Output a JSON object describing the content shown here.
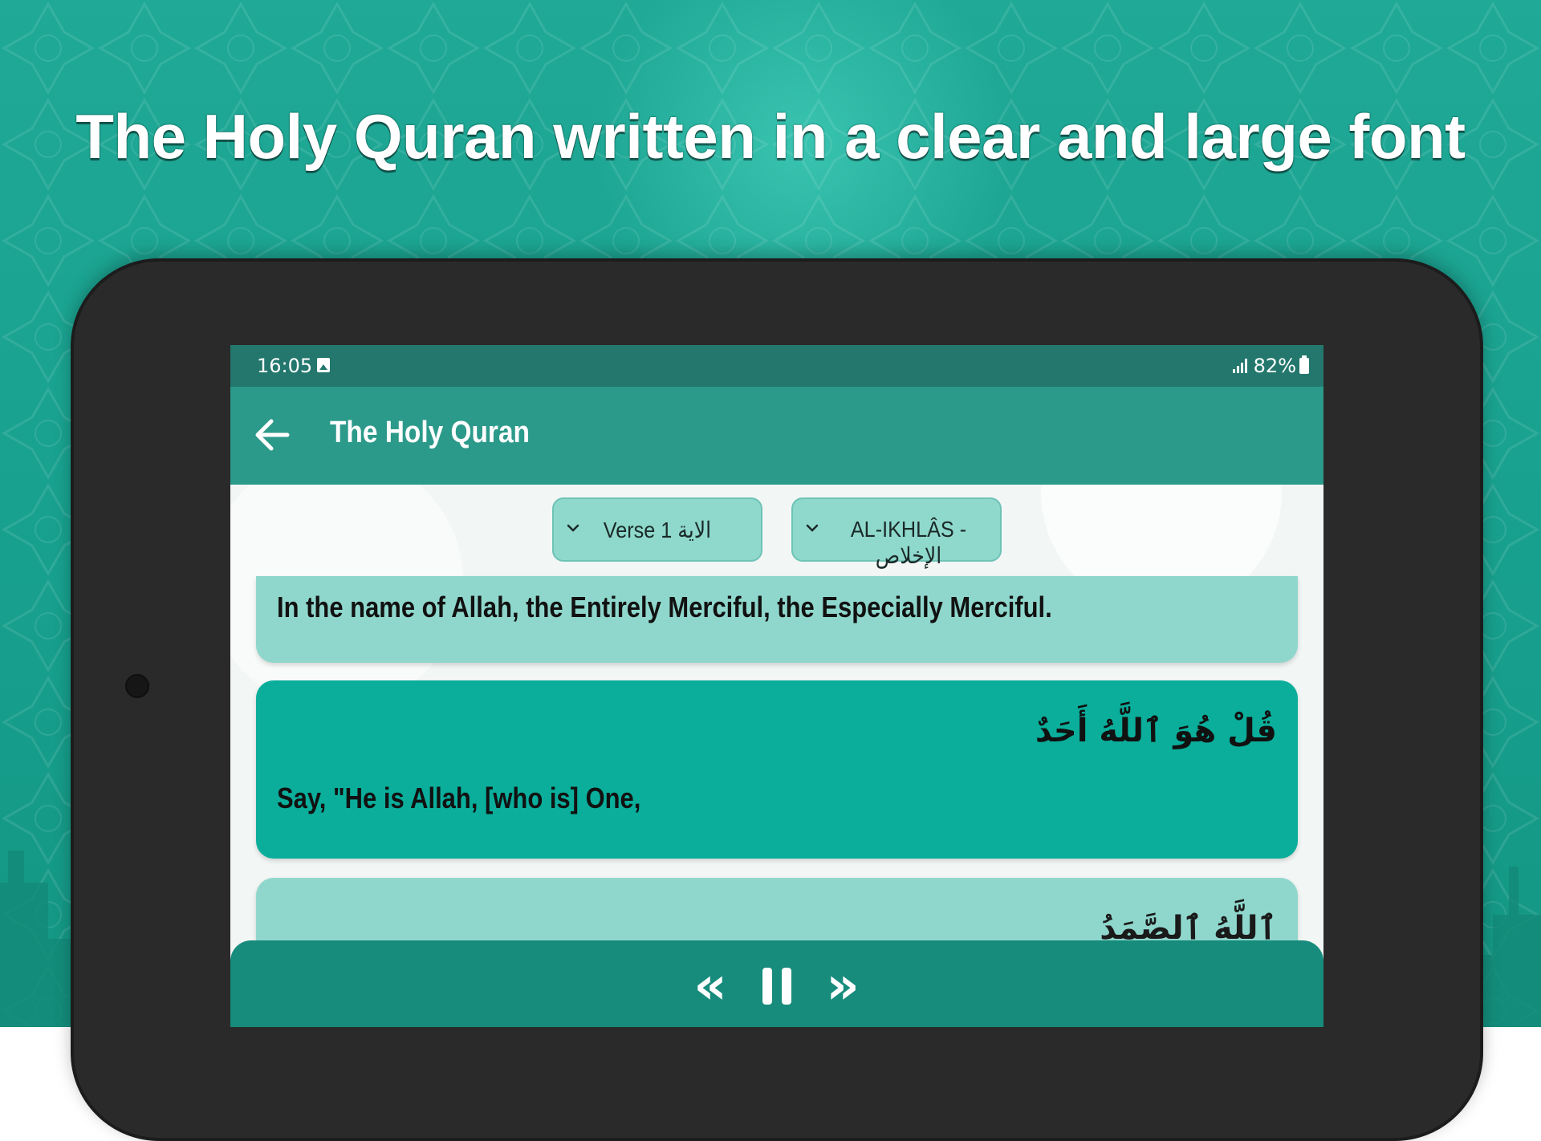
{
  "headline": "The Holy Quran written in a clear and large font",
  "status_bar": {
    "time": "16:05",
    "battery": "82%",
    "icons": [
      "image-icon",
      "signal-icon",
      "battery-icon"
    ]
  },
  "app_bar": {
    "title": "The Holy Quran",
    "back_icon": "arrow-left-icon"
  },
  "selectors": {
    "verse": "Verse 1 الاية",
    "surah": "AL-IKHLÂS - الإخلاص"
  },
  "verses": [
    {
      "arabic": "",
      "translation": "In the name of Allah, the Entirely Merciful, the Especially Merciful."
    },
    {
      "arabic": "قُلْ هُوَ ٱللَّهُ أَحَدٌ",
      "translation": "Say, \"He is Allah, [who is] One,"
    },
    {
      "arabic": "ٱللَّهُ ٱلصَّمَدُ",
      "translation": ""
    }
  ],
  "player": {
    "prev_icon": "double-chevron-left-icon",
    "pause_icon": "pause-icon",
    "next_icon": "double-chevron-right-icon",
    "prev_glyph": "«",
    "next_glyph": "»"
  },
  "colors": {
    "background": "#1fa996",
    "status_bar": "#23776d",
    "app_bar": "#2c9a8a",
    "card_light": "#8fd7cc",
    "card_dark": "#0aae9b",
    "player_bar": "#178b7c"
  }
}
